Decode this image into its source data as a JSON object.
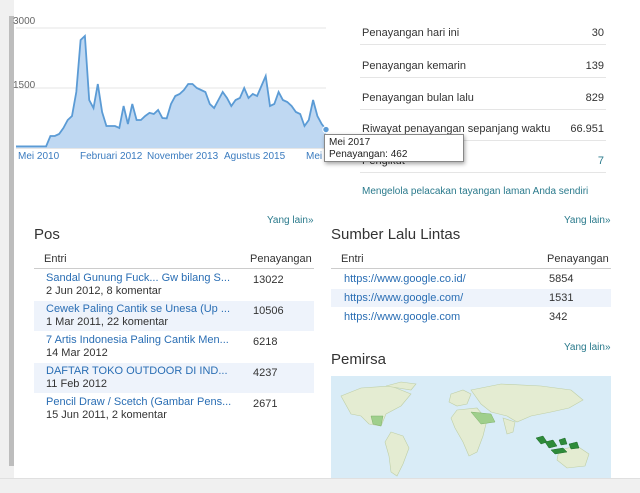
{
  "chart_data": {
    "type": "area",
    "y_ticks": [
      "3000",
      "1500"
    ],
    "ylim": [
      0,
      3200
    ],
    "x_tick_labels": [
      "Mei 2010",
      "Februari 2012",
      "November 2013",
      "Agustus 2015",
      "Mei 2017"
    ],
    "values": [
      40,
      40,
      40,
      40,
      40,
      40,
      40,
      40,
      300,
      300,
      350,
      500,
      700,
      800,
      1400,
      2700,
      2800,
      1200,
      1000,
      1600,
      900,
      550,
      550,
      550,
      500,
      1050,
      600,
      1100,
      700,
      700,
      800,
      880,
      850,
      950,
      750,
      740,
      1100,
      1300,
      1350,
      1450,
      1600,
      1600,
      1500,
      1450,
      1400,
      1100,
      1000,
      1200,
      1400,
      1250,
      1050,
      1200,
      1250,
      1500,
      1250,
      1350,
      1300,
      1550,
      1800,
      1050,
      1100,
      1400,
      1200,
      1150,
      1050,
      900,
      850,
      550,
      700,
      1200,
      800,
      600
    ],
    "highlight": {
      "label": "Mei 2017",
      "value": 462
    },
    "grid": true,
    "fill_color": "#bfd8f2",
    "line_color": "#5b9bd5"
  },
  "tooltip": {
    "title": "Mei 2017",
    "line": "Penayangan: 462"
  },
  "stats": [
    {
      "label": "Penayangan hari ini",
      "value": "30"
    },
    {
      "label": "Penayangan kemarin",
      "value": "139"
    },
    {
      "label": "Penayangan bulan lalu",
      "value": "829"
    },
    {
      "label": "Riwayat penayangan sepanjang waktu",
      "value": "66.951"
    },
    {
      "label": "Pengikut",
      "value": "7"
    }
  ],
  "manage_link": "Mengelola pelacakan tayangan laman Anda sendiri",
  "more_label": "Yang lain»",
  "posts": {
    "title": "Pos",
    "col_entry": "Entri",
    "col_views": "Penayangan",
    "rows": [
      {
        "title": "Sandal Gunung Fuck... Gw bilang S...",
        "meta": "2 Jun 2012, 8 komentar",
        "views": "13022"
      },
      {
        "title": "Cewek Paling Cantik se Unesa (Up ...",
        "meta": "1 Mar 2011, 22 komentar",
        "views": "10506"
      },
      {
        "title": "7 Artis Indonesia Paling Cantik Men...",
        "meta": "14 Mar 2012",
        "views": "6218"
      },
      {
        "title": "DAFTAR TOKO OUTDOOR DI IND...",
        "meta": "11 Feb 2012",
        "views": "4237"
      },
      {
        "title": "Pencil Draw / Scetch (Gambar Pens...",
        "meta": "15 Jun 2011, 2 komentar",
        "views": "2671"
      }
    ]
  },
  "traffic": {
    "title": "Sumber Lalu Lintas",
    "col_entry": "Entri",
    "col_views": "Penayangan",
    "rows": [
      {
        "url": "https://www.google.co.id/",
        "views": "5854"
      },
      {
        "url": "https://www.google.com/",
        "views": "1531"
      },
      {
        "url": "https://www.google.com",
        "views": "342"
      }
    ]
  },
  "audience": {
    "title": "Pemirsa"
  }
}
